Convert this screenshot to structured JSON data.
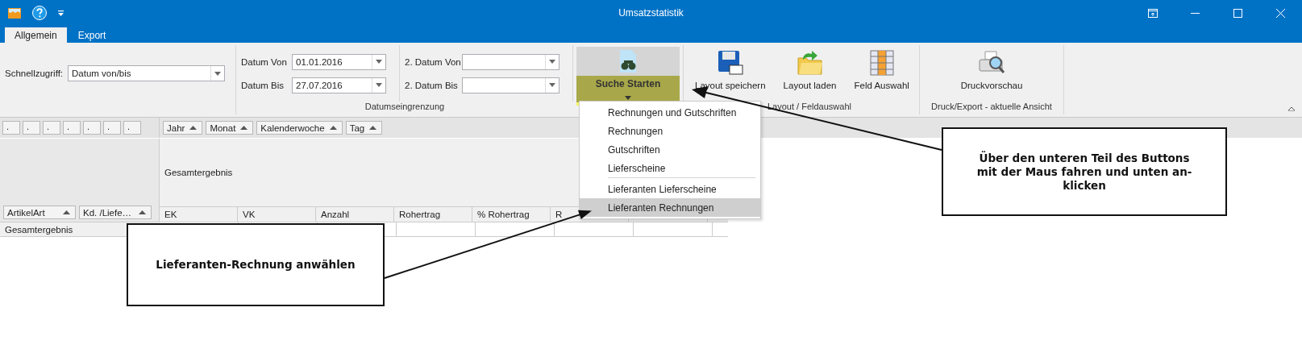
{
  "window": {
    "title": "Umsatzstatistik"
  },
  "tabs": [
    {
      "label": "Allgemein",
      "selected": true
    },
    {
      "label": "Export",
      "selected": false
    }
  ],
  "ribbon": {
    "quick_access": {
      "label": "Schnellzugriff:",
      "value": "Datum von/bis"
    },
    "date_fields": [
      {
        "label": "Datum Von",
        "value": "01.01.2016"
      },
      {
        "label": "Datum Bis",
        "value": "27.07.2016"
      }
    ],
    "second_date_fields": [
      {
        "label": "2. Datum Von"
      },
      {
        "label": "2. Datum Bis"
      }
    ],
    "date_caption": "Datumseingrenzung",
    "search_button": {
      "label": "Suche Starten",
      "hovered": true
    },
    "layout_buttons": [
      {
        "label": "Layout speichern",
        "kind": "save"
      },
      {
        "label": "Layout laden",
        "kind": "load"
      },
      {
        "label": "Feld Auswahl",
        "kind": "fields"
      }
    ],
    "layout_caption": "Layout / Feldauswahl",
    "export_buttons": [
      {
        "label": "Druckvorschau",
        "kind": "preview"
      }
    ],
    "export_caption": "Druck/Export - aktuelle Ansicht"
  },
  "dropdown": {
    "items": [
      {
        "label": "Rechnungen und Gutschriften",
        "selected": false,
        "divider_before": false
      },
      {
        "label": "Rechnungen",
        "selected": false,
        "divider_before": false
      },
      {
        "label": "Gutschriften",
        "selected": false,
        "divider_before": false
      },
      {
        "label": "Lieferscheine",
        "selected": false,
        "divider_before": false
      },
      {
        "label": "Lieferanten Lieferscheine",
        "selected": false,
        "divider_before": true
      },
      {
        "label": "Lieferanten Rechnungen",
        "selected": true,
        "divider_before": false
      }
    ]
  },
  "pivot": {
    "filter_buttons": [
      ".",
      ".",
      ".",
      ".",
      ".",
      ".",
      "."
    ],
    "column_fields": [
      "Jahr",
      "Monat",
      "Kalenderwoche",
      "Tag"
    ],
    "grand_total_header": "Gesamtergebnis",
    "row_fields": [
      "ArtikelArt",
      "Kd. /Liefe…"
    ],
    "data_fields": [
      "EK",
      "VK",
      "Anzahl",
      "Rohertrag",
      "% Rohertrag",
      "R"
    ],
    "rows": [
      {
        "label": "Gesamtergebnis"
      }
    ]
  },
  "callouts": [
    {
      "text": "Über den unteren Teil des Buttons mit der Maus fahren und unten an-klicken"
    },
    {
      "text": "Lieferanten-Rechnung anwählen"
    }
  ]
}
